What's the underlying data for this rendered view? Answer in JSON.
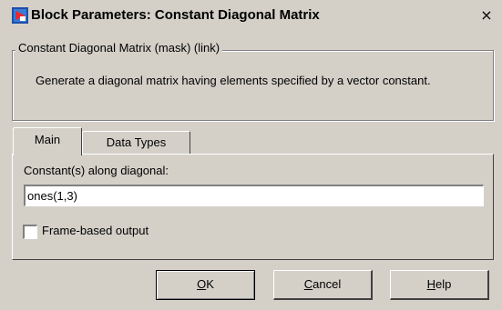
{
  "window": {
    "title": "Block Parameters: Constant Diagonal Matrix",
    "close_symbol": "×"
  },
  "group": {
    "legend": "Constant Diagonal Matrix (mask) (link)",
    "description": "Generate a diagonal matrix having elements specified by a vector constant."
  },
  "tabs": [
    {
      "label": "Main",
      "selected": true
    },
    {
      "label": "Data Types",
      "selected": false
    }
  ],
  "main": {
    "constant_label": "Constant(s) along diagonal:",
    "constant_value": "ones(1,3)",
    "frame_checkbox_label": "Frame-based output",
    "frame_checked": false
  },
  "buttons": {
    "ok": {
      "mnemonic": "O",
      "rest": "K"
    },
    "cancel": {
      "mnemonic": "C",
      "rest": "ancel"
    },
    "help": {
      "mnemonic": "H",
      "rest": "elp"
    }
  }
}
